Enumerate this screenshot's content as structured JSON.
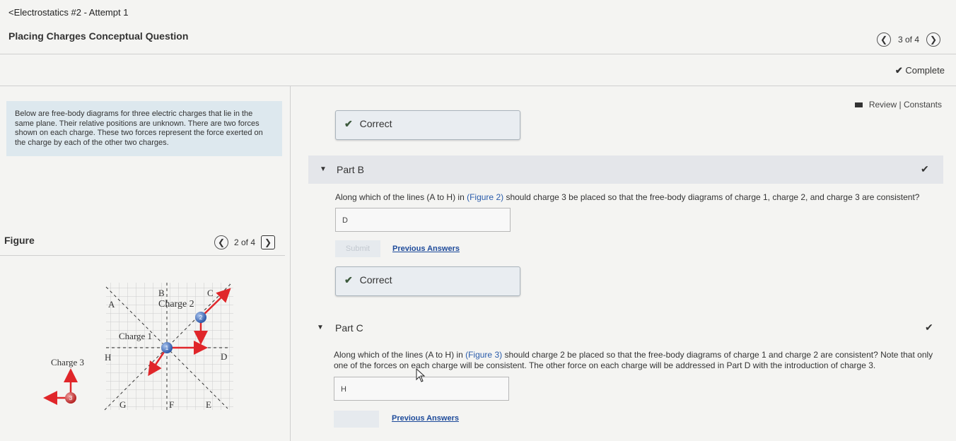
{
  "header": {
    "breadcrumb": "<Electrostatics #2 - Attempt 1",
    "title": "Placing Charges Conceptual Question",
    "pager": {
      "text": "3 of 4"
    },
    "status": "Complete",
    "review_links": "Review | Constants"
  },
  "intro": {
    "text": "Below are free-body diagrams for three electric charges that lie in the same plane. Their relative positions are unknown. There are two forces shown on each charge. These two forces represent the force exerted on the charge by each of the other two charges."
  },
  "figure": {
    "label": "Figure",
    "pager": "2 of 4",
    "line_labels": {
      "a": "A",
      "b": "B",
      "c": "C",
      "d": "D",
      "e": "E",
      "f": "F",
      "g": "G",
      "h": "H"
    },
    "charge1_label": "Charge 1",
    "charge2_label": "Charge 2",
    "charge3_label": "Charge 3",
    "charge1_num": "1",
    "charge2_num": "2",
    "charge3_num": "3"
  },
  "partA": {
    "feedback": "Correct"
  },
  "partB": {
    "title": "Part B",
    "question_pre": "Along which of the lines (A to H) in ",
    "figure_link": "(Figure 2)",
    "question_post": " should charge 3 be placed so that the free-body diagrams of charge 1, charge 2, and charge 3 are consistent?",
    "answer": "D",
    "submit_label": "Submit",
    "previous_answers": "Previous Answers",
    "feedback": "Correct"
  },
  "partC": {
    "title": "Part C",
    "question_pre": "Along which of the lines (A to H) in ",
    "figure_link": "(Figure 3)",
    "question_post": " should charge 2 be placed so that the free-body diagrams of charge 1 and charge 2 are consistent? Note that only one of the forces on each charge will be consistent. The other force on each charge will be addressed in Part D with the introduction of charge 3.",
    "answer": "H",
    "previous_answers": "Previous Answers"
  },
  "colors": {
    "force_arrow": "#e0262a",
    "charge_blue": "#4a7ac8",
    "charge_red": "#d23a3a",
    "link": "#2a5cab"
  }
}
